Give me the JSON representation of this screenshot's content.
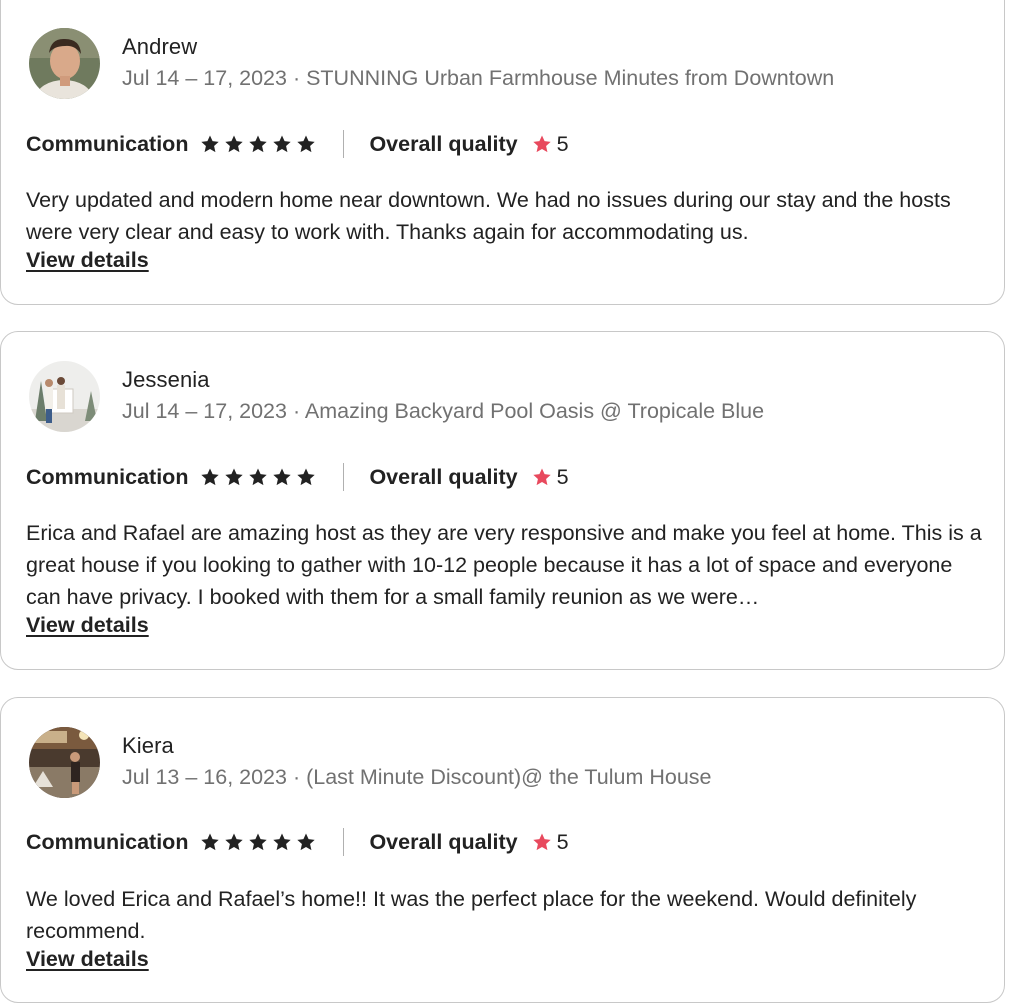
{
  "reviews": [
    {
      "name": "Andrew",
      "stay": "Jul 14 – 17, 2023 · STUNNING Urban Farmhouse Minutes from Downtown",
      "communication_label": "Communication",
      "communication_stars": 5,
      "overall_label": "Overall quality",
      "overall_value": "5",
      "text": "Very updated and modern home near downtown. We had no issues during our stay and the hosts were very clear and easy to work with. Thanks again for accommodating us.",
      "link": "View details"
    },
    {
      "name": "Jessenia",
      "stay": "Jul 14 – 17, 2023 · Amazing Backyard Pool Oasis @ Tropicale Blue",
      "communication_label": "Communication",
      "communication_stars": 5,
      "overall_label": "Overall quality",
      "overall_value": "5",
      "text": "Erica and Rafael are amazing host as they are very responsive and make you feel at home. This is a great house if you looking to gather with 10-12 people because it has a lot of space and everyone can have privacy. I booked with them for a small family reunion as we were…",
      "link": "View details"
    },
    {
      "name": "Kiera",
      "stay": "Jul 13 – 16, 2023 · (Last Minute Discount)@ the Tulum House",
      "communication_label": "Communication",
      "communication_stars": 5,
      "overall_label": "Overall quality",
      "overall_value": "5",
      "text": "We loved Erica and Rafael’s home!! It was the perfect place for the weekend. Would definitely recommend.",
      "link": "View details"
    }
  ],
  "colors": {
    "text": "#222222",
    "muted": "#717171",
    "accent_star": "#e8495d",
    "border": "#c8c8c8"
  }
}
